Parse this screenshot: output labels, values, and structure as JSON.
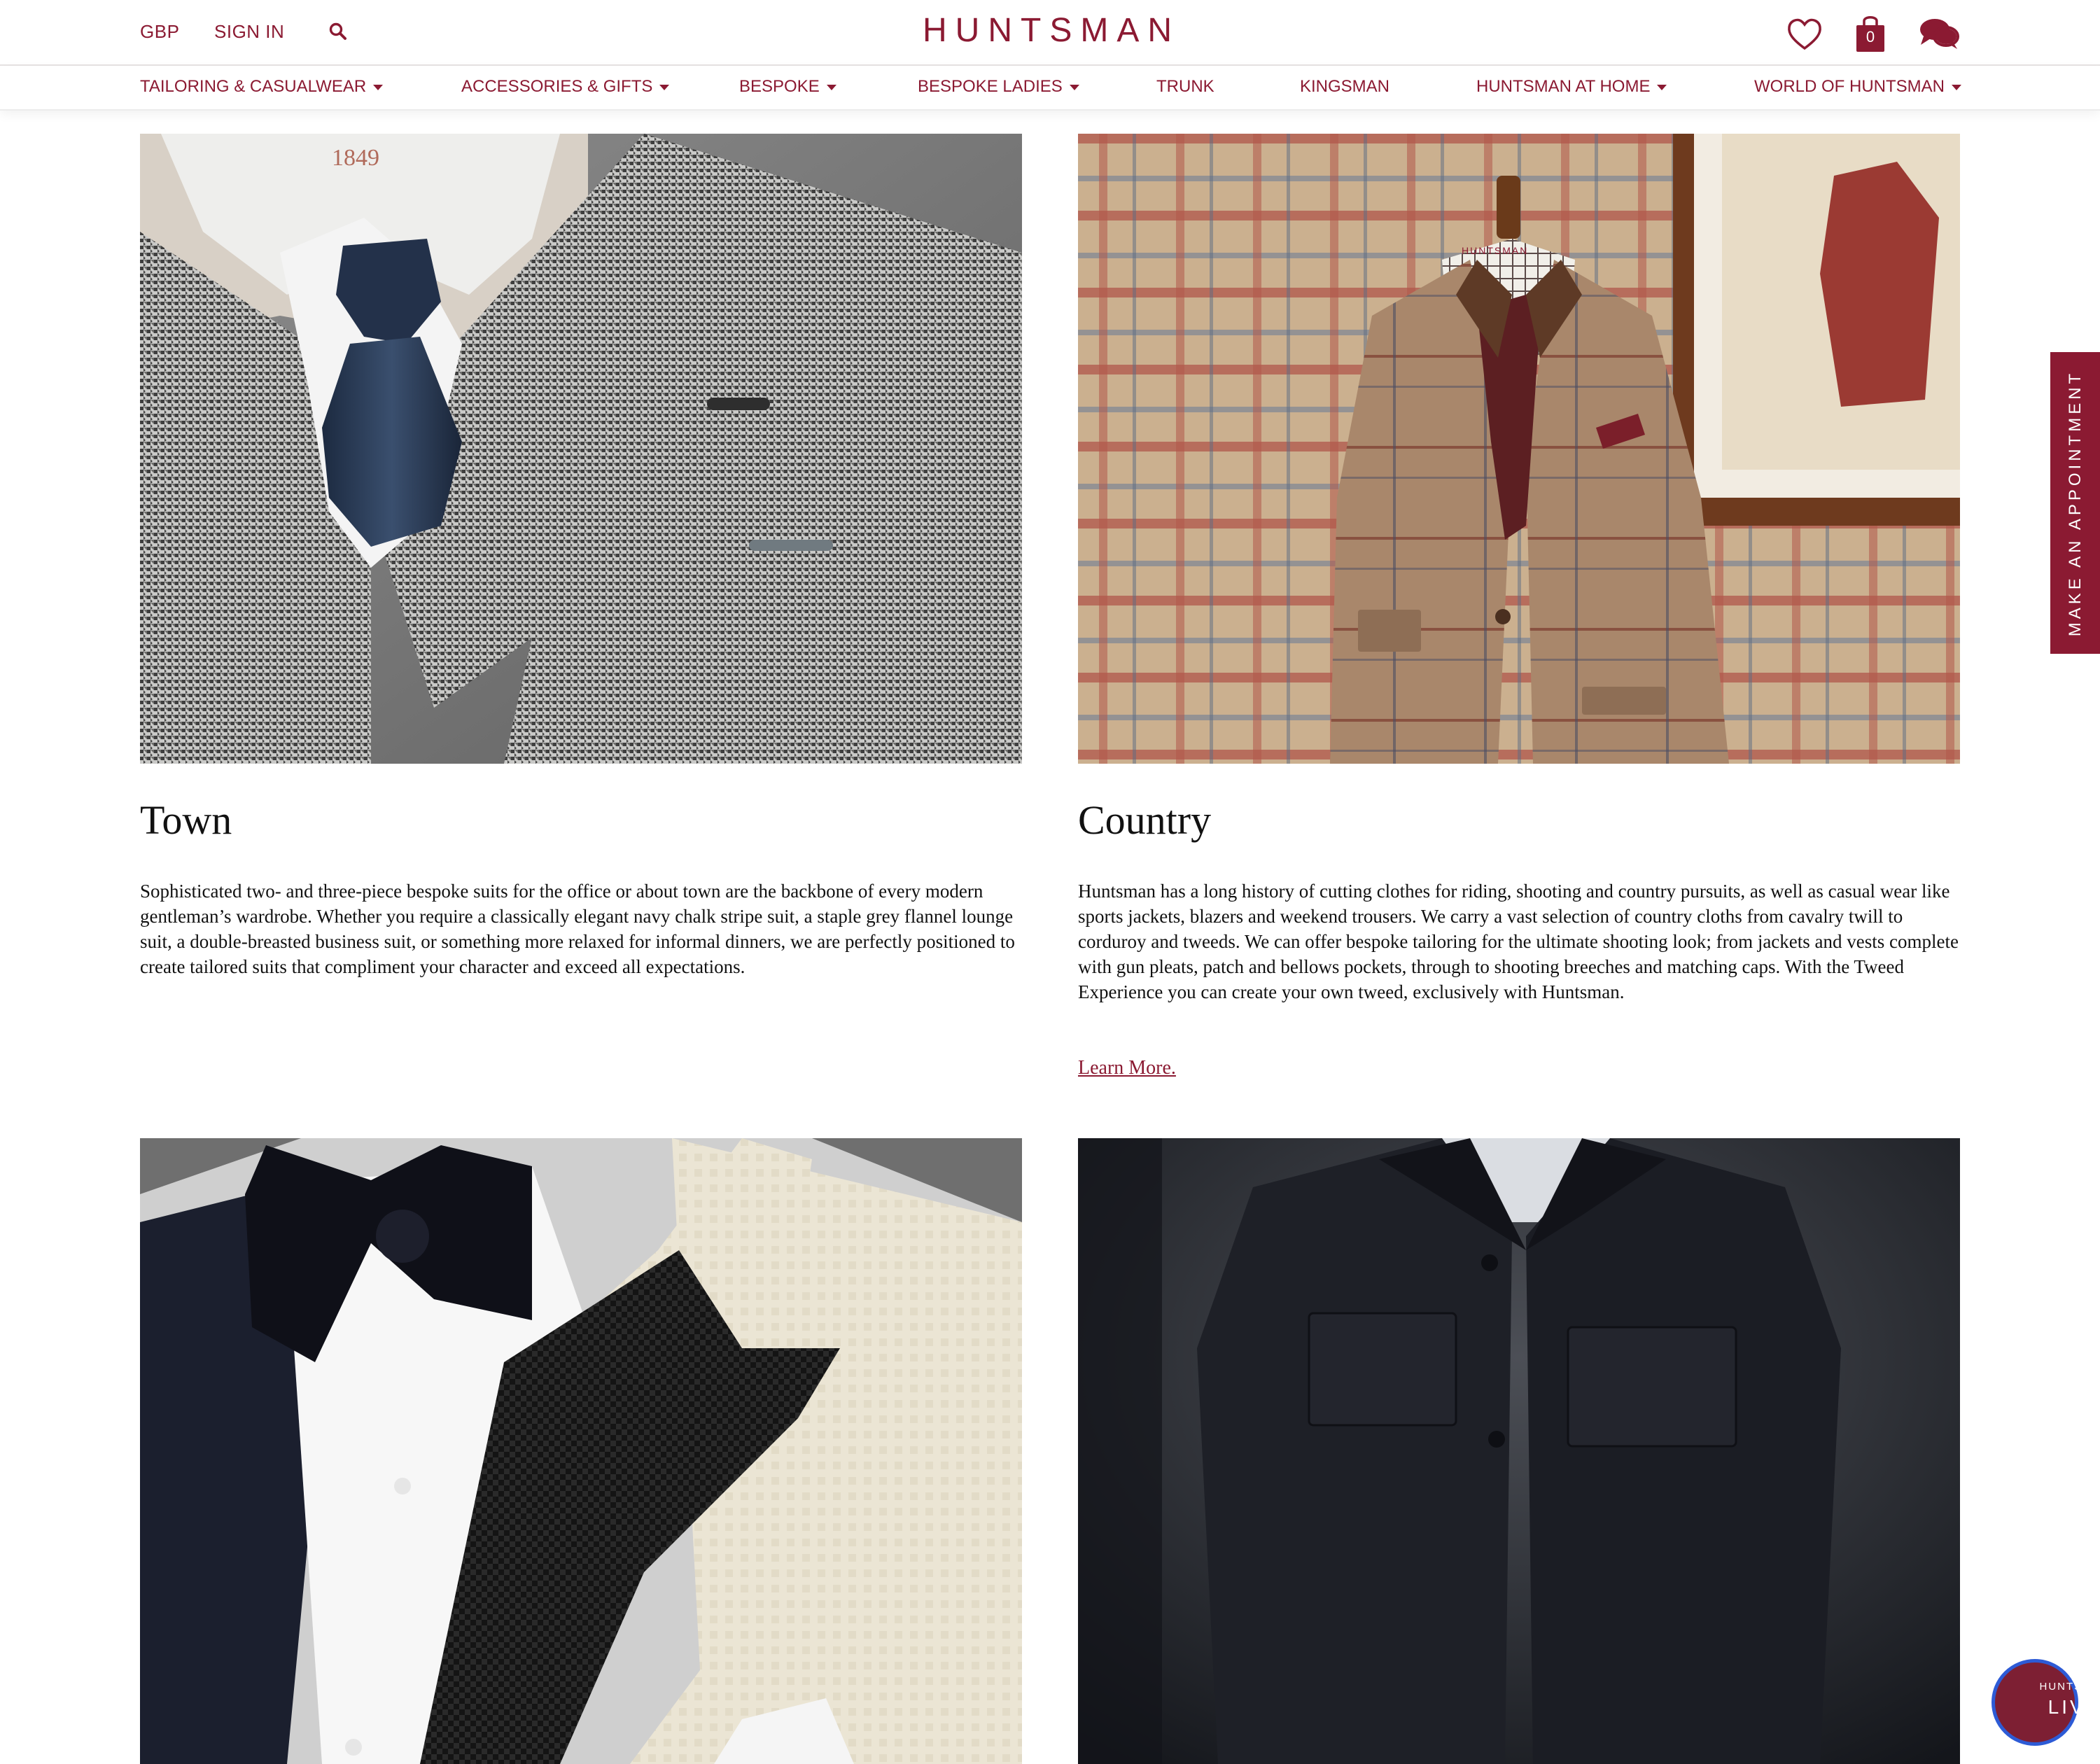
{
  "header": {
    "currency": "GBP",
    "sign_in": "SIGN IN",
    "logo": "HUNTSMAN",
    "cart_count": "0",
    "icons": [
      "search-icon",
      "heart-icon",
      "shopping-bag-icon",
      "chat-icon"
    ]
  },
  "nav": {
    "items": [
      {
        "label": "TAILORING & CASUALWEAR",
        "dropdown": true
      },
      {
        "label": "ACCESSORIES & GIFTS",
        "dropdown": true
      },
      {
        "label": "BESPOKE",
        "dropdown": true
      },
      {
        "label": "BESPOKE LADIES",
        "dropdown": true
      },
      {
        "label": "TRUNK",
        "dropdown": false
      },
      {
        "label": "KINGSMAN",
        "dropdown": false
      },
      {
        "label": "HUNTSMAN AT HOME",
        "dropdown": true
      },
      {
        "label": "WORLD OF HUNTSMAN",
        "dropdown": true
      }
    ]
  },
  "sections": {
    "town": {
      "title": "Town",
      "body": "Sophisticated two- and three-piece bespoke suits for the office or about town are the backbone of every modern gentleman’s wardrobe. Whether you require a classically elegant navy chalk stripe suit, a staple grey flannel lounge suit, a double-breasted business suit, or something more relaxed for informal dinners, we are perfectly positioned to create tailored suits that compliment your character and exceed all expectations.",
      "mannequin_mark": "1849"
    },
    "country": {
      "title": "Country",
      "body": "Huntsman has a long history of cutting clothes for riding, shooting and country pursuits, as well as casual wear like sports jackets, blazers and weekend trousers. We carry a vast selection of country cloths from cavalry twill to corduroy and tweeds. We can offer bespoke tailoring for the ultimate shooting look; from jackets and vests complete with gun pleats, patch and bellows pockets, through to shooting breeches and matching caps. With the Tweed Experience you can create your own tweed, exclusively with Huntsman.",
      "link": "Learn More.",
      "mannequin_mark": "HUNTSMAN"
    }
  },
  "side_tab": {
    "label": "MAKE AN APPOINTMENT"
  },
  "live_badge": {
    "top": "HUNTSMAN",
    "main": "LIVE"
  },
  "colors": {
    "brand": "#8b1a32",
    "text": "#111111",
    "divider": "#e6e2e2"
  }
}
